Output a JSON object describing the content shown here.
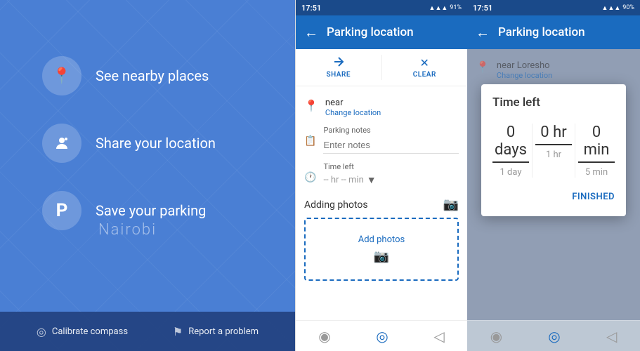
{
  "panel1": {
    "menu": {
      "items": [
        {
          "id": "nearby",
          "label": "See nearby places",
          "icon": "📍"
        },
        {
          "id": "share",
          "label": "Share your location",
          "icon": "👤"
        },
        {
          "id": "parking",
          "label": "Save your parking",
          "icon": "P"
        }
      ]
    },
    "map_city": "Nairobi",
    "bottom_bar": {
      "calibrate_label": "Calibrate compass",
      "report_label": "Report a problem"
    }
  },
  "panel2": {
    "status_bar": {
      "time": "17:51",
      "icons": "📶 91%"
    },
    "header": {
      "back_icon": "←",
      "title": "Parking location"
    },
    "actions": {
      "share_label": "SHARE",
      "clear_label": "CLEAR"
    },
    "location": {
      "name": "near",
      "change_label": "Change location"
    },
    "notes": {
      "label": "Parking notes",
      "placeholder": "Enter notes"
    },
    "time": {
      "label": "Time left",
      "value": "-- hr -- min"
    },
    "photos": {
      "label": "Adding photos",
      "add_label": "Add photos"
    }
  },
  "panel3": {
    "status_bar": {
      "time": "17:51",
      "icons": "📶 90%"
    },
    "header": {
      "back_icon": "←",
      "title": "Parking location"
    },
    "location": {
      "name": "near Loresho",
      "change_label": "Change location"
    },
    "time_modal": {
      "title": "Time left",
      "days": {
        "value": "0 days",
        "below": "1 day"
      },
      "hr": {
        "value": "0 hr",
        "below": "1 hr"
      },
      "min": {
        "value": "0 min",
        "below": "5 min"
      },
      "finished_label": "FINISHED"
    }
  }
}
